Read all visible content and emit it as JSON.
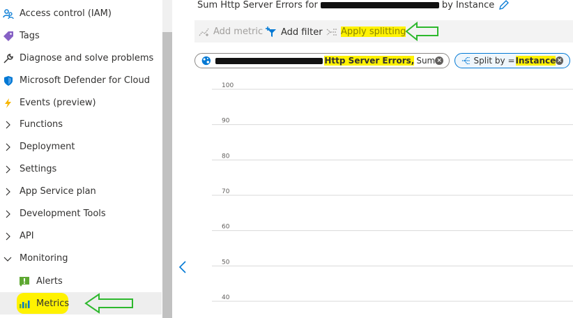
{
  "sidebar": {
    "items": [
      {
        "label": "Access control (IAM)",
        "icon": "people-icon"
      },
      {
        "label": "Tags",
        "icon": "tag-icon"
      },
      {
        "label": "Diagnose and solve problems",
        "icon": "wrench-icon"
      },
      {
        "label": "Microsoft Defender for Cloud",
        "icon": "shield-icon"
      },
      {
        "label": "Events (preview)",
        "icon": "lightning-icon"
      },
      {
        "label": "Functions",
        "icon": "chevron-right-icon"
      },
      {
        "label": "Deployment",
        "icon": "chevron-right-icon"
      },
      {
        "label": "Settings",
        "icon": "chevron-right-icon"
      },
      {
        "label": "App Service plan",
        "icon": "chevron-right-icon"
      },
      {
        "label": "Development Tools",
        "icon": "chevron-right-icon"
      },
      {
        "label": "API",
        "icon": "chevron-right-icon"
      },
      {
        "label": "Monitoring",
        "icon": "chevron-down-icon"
      }
    ],
    "sub_items": [
      {
        "label": "Alerts",
        "icon": "alert-icon"
      },
      {
        "label": "Metrics",
        "icon": "metrics-icon",
        "selected": true
      }
    ]
  },
  "main": {
    "title_prefix": "Sum Http Server Errors for",
    "title_suffix": "by Instance",
    "toolbar": {
      "add_metric": "Add metric",
      "add_filter": "Add filter",
      "apply_splitting": "Apply splitting"
    },
    "metric_chip": {
      "metric_name": "Http Server Errors,",
      "aggregation": "Sum"
    },
    "split_chip": {
      "prefix": "Split by =",
      "value": "Instance"
    }
  },
  "chart_data": {
    "type": "line",
    "y_ticks": [
      100,
      90,
      80,
      70,
      60,
      50,
      40
    ],
    "ylim": [
      40,
      100
    ],
    "grid": true
  },
  "colors": {
    "highlight": "#fff200",
    "accent": "#0078d4",
    "arrow": "#2db82d"
  }
}
